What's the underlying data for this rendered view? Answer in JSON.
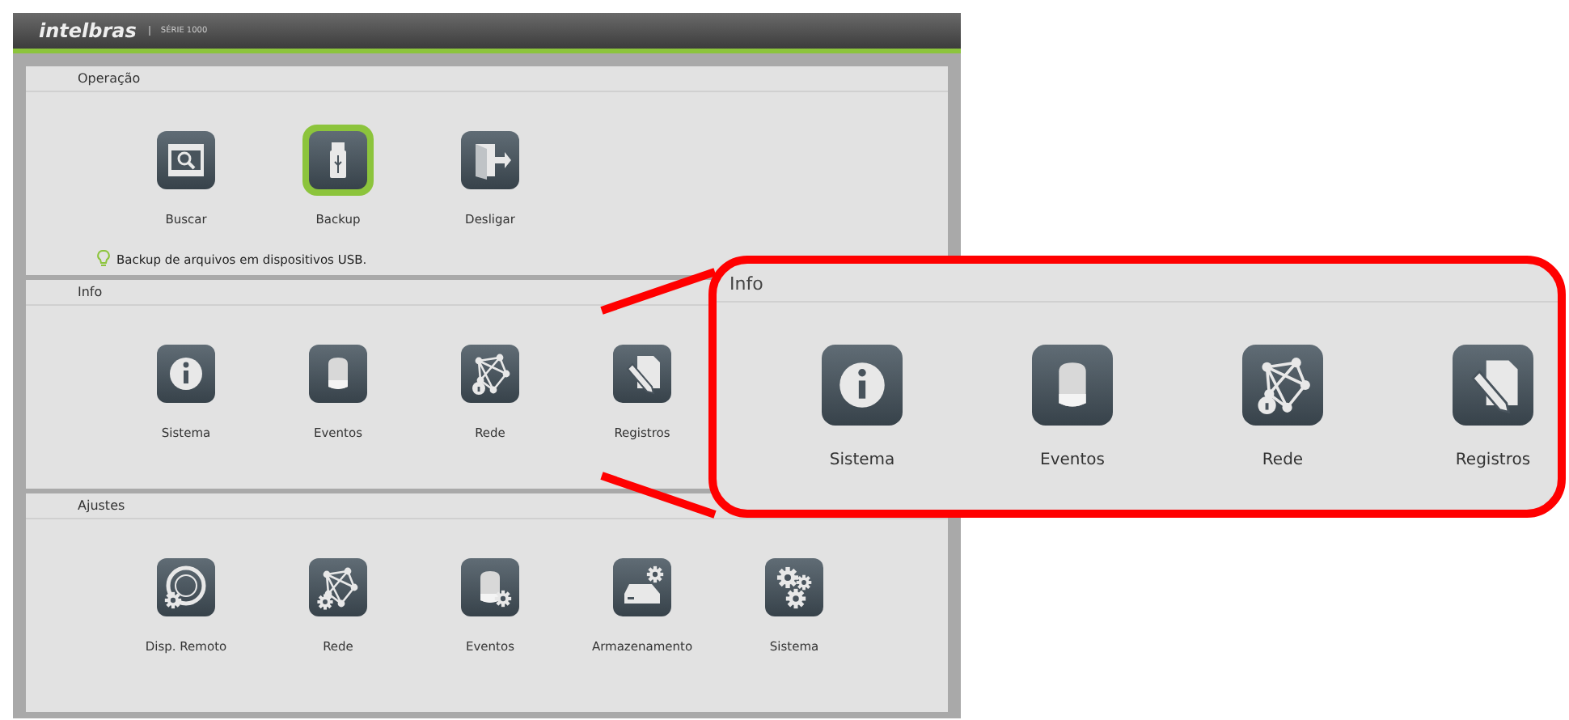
{
  "header": {
    "logo": "intelbras",
    "series": "SÉRIE 1000"
  },
  "sections": [
    {
      "title": "Operação",
      "items": [
        {
          "label": "Buscar",
          "kind": "film-search",
          "selected": false
        },
        {
          "label": "Backup",
          "kind": "usb",
          "selected": true
        },
        {
          "label": "Desligar",
          "kind": "exit",
          "selected": false
        }
      ],
      "hint": "Backup de arquivos em dispositivos USB."
    },
    {
      "title": "Info",
      "items": [
        {
          "label": "Sistema",
          "kind": "info",
          "selected": false
        },
        {
          "label": "Eventos",
          "kind": "siren",
          "selected": false
        },
        {
          "label": "Rede",
          "kind": "network-info",
          "selected": false
        },
        {
          "label": "Registros",
          "kind": "log",
          "selected": false
        }
      ]
    },
    {
      "title": "Ajustes",
      "items": [
        {
          "label": "Disp. Remoto",
          "kind": "camera-gear",
          "selected": false
        },
        {
          "label": "Rede",
          "kind": "network-gear",
          "selected": false
        },
        {
          "label": "Eventos",
          "kind": "siren-gear",
          "selected": false
        },
        {
          "label": "Armazenamento",
          "kind": "disk-gear",
          "selected": false
        },
        {
          "label": "Sistema",
          "kind": "gears",
          "selected": false
        }
      ]
    }
  ],
  "callout": {
    "title": "Info",
    "items": [
      {
        "label": "Sistema",
        "kind": "info"
      },
      {
        "label": "Eventos",
        "kind": "siren"
      },
      {
        "label": "Rede",
        "kind": "network-info"
      },
      {
        "label": "Registros",
        "kind": "log"
      }
    ]
  }
}
